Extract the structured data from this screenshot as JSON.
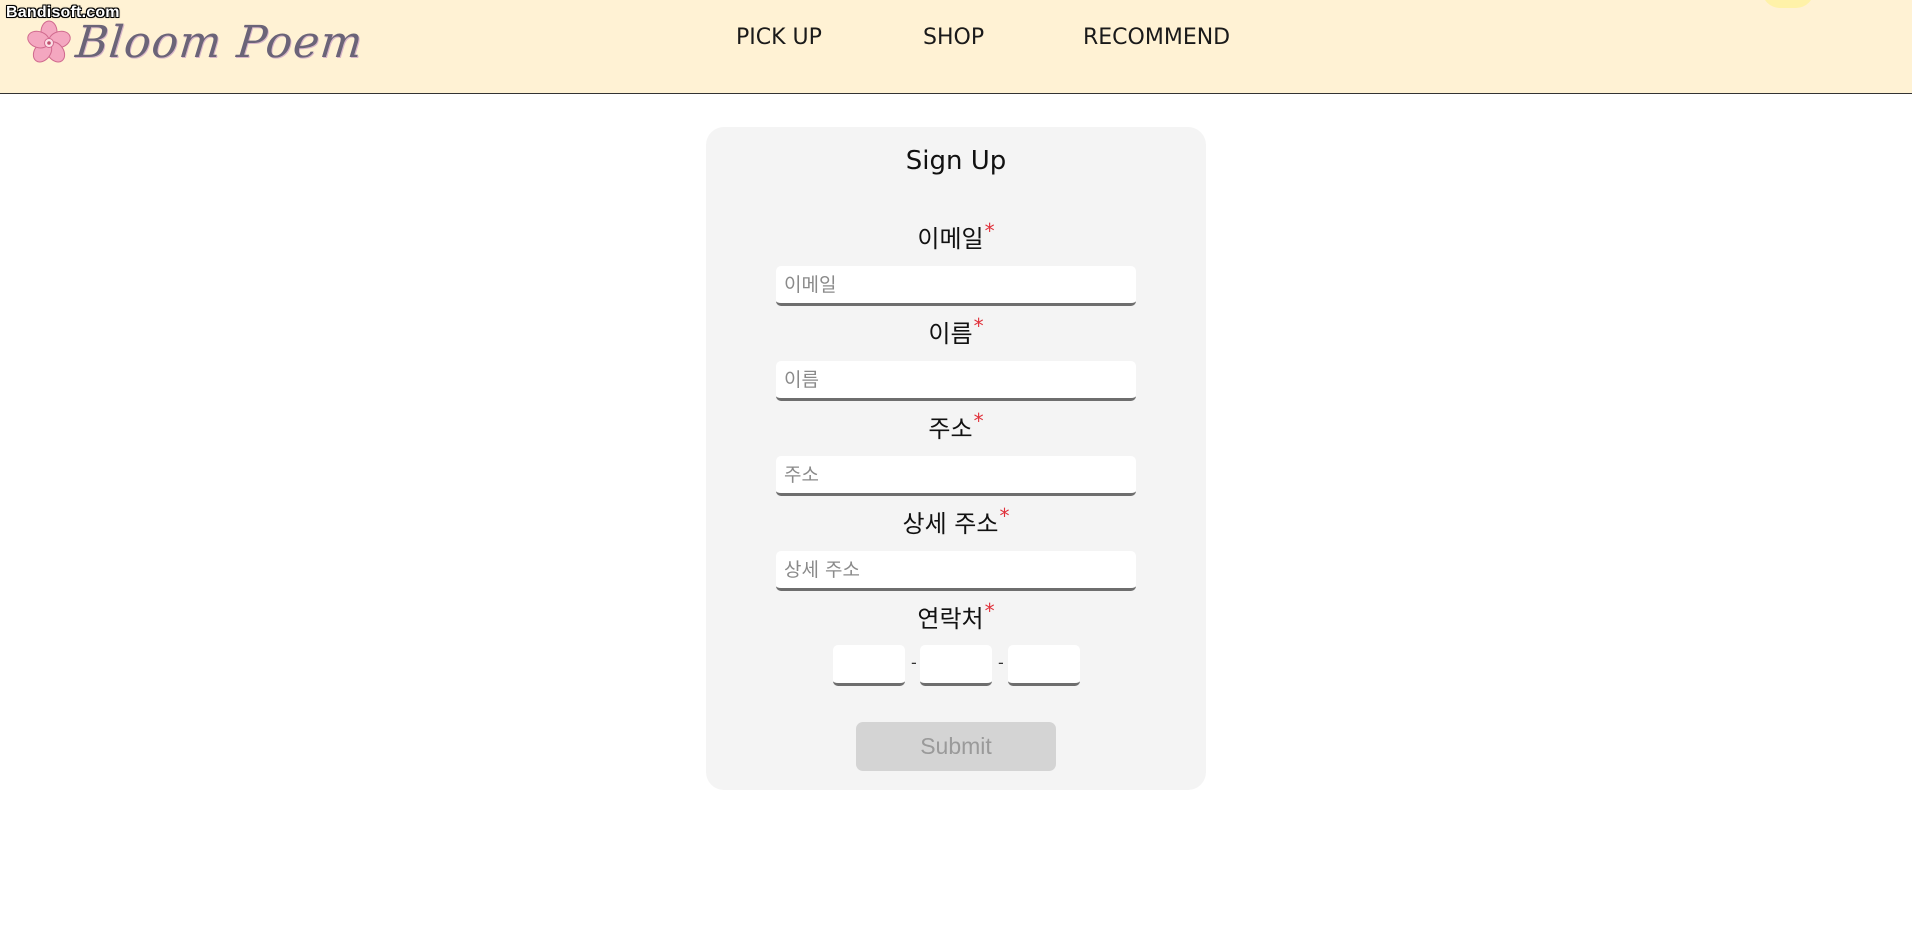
{
  "watermark": "Bandisoft.com",
  "header": {
    "logo_text": "Bloom Poem",
    "nav": [
      "PICK UP",
      "SHOP",
      "RECOMMEND"
    ]
  },
  "form": {
    "title": "Sign Up",
    "required_mark": "*",
    "fields": [
      {
        "label": "이메일",
        "placeholder": "이메일"
      },
      {
        "label": "이름",
        "placeholder": "이름"
      },
      {
        "label": "주소",
        "placeholder": "주소"
      },
      {
        "label": "상세 주소",
        "placeholder": "상세 주소"
      }
    ],
    "phone": {
      "label": "연락처",
      "separator": "-"
    },
    "submit_label": "Submit"
  },
  "colors": {
    "header_bg": "#fff2d4",
    "card_bg": "#f4f4f4",
    "required": "#e0303a",
    "submit_disabled_bg": "#d4d4d4",
    "submit_disabled_text": "#9a9a9a"
  },
  "icons": {
    "logo": "cherry-blossom-icon"
  }
}
